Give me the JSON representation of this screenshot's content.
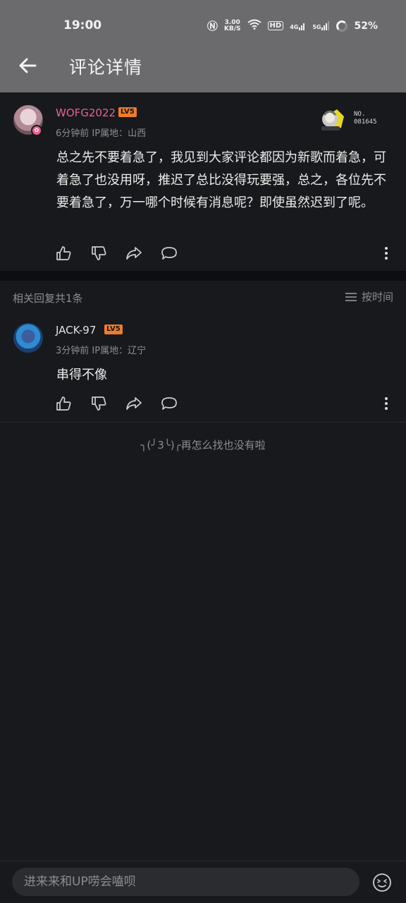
{
  "status_bar": {
    "time": "19:00",
    "net_speed_value": "3.00",
    "net_speed_unit": "KB/S",
    "hd_label": "HD",
    "net_4g": "4G",
    "net_5g": "5G",
    "battery": "52%"
  },
  "header": {
    "title": "评论详情"
  },
  "main_comment": {
    "username": "WOFG2022",
    "level": "LV5",
    "time_ago": "6分钟前",
    "ip_location": "IP属地：山西",
    "fan_badge_no_label": "NO.",
    "fan_badge_no": "081645",
    "content": "总之先不要着急了，我见到大家评论都因为新歌而着急，可着急了也没用呀，推迟了总比没得玩要强，总之，各位先不要着急了，万一哪个时候有消息呢？即使虽然迟到了呢。"
  },
  "replies_header": {
    "count_text": "相关回复共1条",
    "sort_label": "按时间"
  },
  "replies": [
    {
      "username": "JACK-97",
      "level": "LV5",
      "time_ago": "3分钟前",
      "ip_location": "IP属地：辽宁",
      "content": "串得不像"
    }
  ],
  "end_tip": "╮(╯3╰)╭再怎么找也没有啦",
  "input": {
    "placeholder": "进来来和UP唠会嗑呗"
  },
  "colors": {
    "accent_pink": "#e8628f",
    "level_orange": "#ee7c2a",
    "header_bg": "#6b6b6d",
    "page_bg": "#18191c"
  },
  "icons": [
    "back-arrow-icon",
    "thumb-up-icon",
    "thumb-down-icon",
    "share-icon",
    "comment-icon",
    "more-icon",
    "sort-icon",
    "emoji-icon"
  ]
}
